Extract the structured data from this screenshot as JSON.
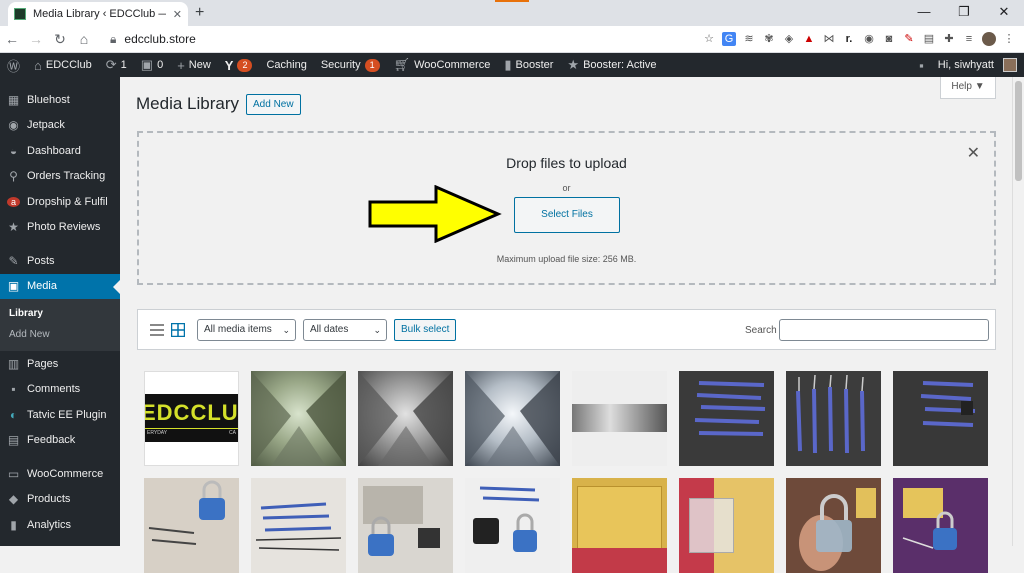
{
  "browser": {
    "tab_title": "Media Library ‹ EDCClub — WordPress",
    "tab_close": "✕",
    "new_tab": "+",
    "url": "edcclub.store",
    "win_minimize": "—",
    "win_restore": "❐",
    "win_close": "✕"
  },
  "adminbar": {
    "site_name": "EDCClub",
    "updates_count": "1",
    "comments_count": "0",
    "new_label": "New",
    "yoast_badge": "2",
    "caching_label": "Caching",
    "security_label": "Security",
    "security_badge": "1",
    "woo_label": "WooCommerce",
    "booster_label": "Booster",
    "booster_active_label": "Booster: Active",
    "greeting": "Hi, siwhyatt"
  },
  "sidebar": {
    "items": [
      {
        "label": "Bluehost",
        "icon": "grid"
      },
      {
        "label": "Jetpack",
        "icon": "bolt"
      },
      {
        "label": "Dashboard",
        "icon": "gauge"
      },
      {
        "label": "Orders Tracking",
        "icon": "pin"
      },
      {
        "label": "Dropship & Fulfil",
        "icon": "a"
      },
      {
        "label": "Photo Reviews",
        "icon": "star"
      },
      {
        "label": "Posts",
        "icon": "pin"
      },
      {
        "label": "Media",
        "icon": "media"
      },
      {
        "label": "Pages",
        "icon": "page"
      },
      {
        "label": "Comments",
        "icon": "comment"
      },
      {
        "label": "Tatvic EE Plugin",
        "icon": "globe"
      },
      {
        "label": "Feedback",
        "icon": "feedback"
      },
      {
        "label": "WooCommerce",
        "icon": "woo"
      },
      {
        "label": "Products",
        "icon": "box"
      },
      {
        "label": "Analytics",
        "icon": "bars"
      }
    ],
    "media_sub": {
      "library": "Library",
      "add_new": "Add New"
    }
  },
  "page": {
    "title": "Media Library",
    "add_new": "Add New",
    "help": "Help ▼"
  },
  "uploader": {
    "title": "Drop files to upload",
    "or": "or",
    "button": "Select Files",
    "max_size": "Maximum upload file size: 256 MB.",
    "close": "✕"
  },
  "filters": {
    "media_type": "All media items",
    "dates": "All dates",
    "bulk": "Bulk select",
    "search_label": "Search"
  },
  "thumbnails": [
    {
      "name": "edcclub-banner",
      "text": "EDCCLUB",
      "sub_left": "ERYDAY",
      "sub_right": "CA"
    },
    {
      "name": "skyscrapers-green"
    },
    {
      "name": "skyscrapers-gray"
    },
    {
      "name": "skyscrapers-blue"
    },
    {
      "name": "skyscrapers-strip"
    },
    {
      "name": "lockpicks-blue-1"
    },
    {
      "name": "lockpicks-blue-2"
    },
    {
      "name": "lockpicks-blue-3"
    },
    {
      "name": "lock-kit-1"
    },
    {
      "name": "lock-kit-2"
    },
    {
      "name": "lock-kit-3"
    },
    {
      "name": "lock-kit-4"
    },
    {
      "name": "envelope-yellow"
    },
    {
      "name": "envelope-bag"
    },
    {
      "name": "lock-hand"
    },
    {
      "name": "lock-purple"
    }
  ]
}
